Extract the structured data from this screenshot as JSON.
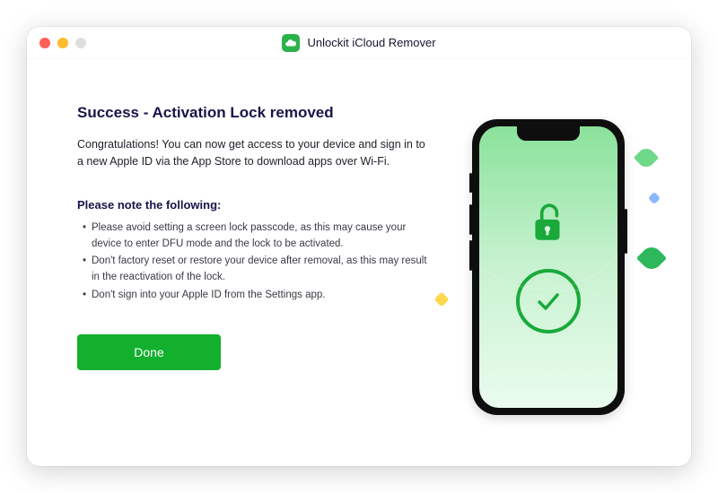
{
  "app": {
    "title": "Unlockit iCloud Remover"
  },
  "main": {
    "heading": "Success - Activation Lock removed",
    "intro": "Congratulations! You can now get access to your device and sign in to a new Apple ID via the App Store to download apps over Wi-Fi.",
    "note_heading": "Please note the following:",
    "notes": [
      "Please avoid setting a screen lock passcode, as this may cause your device to enter DFU mode and the lock to be activated.",
      "Don't factory reset or restore your device after removal, as this may result in the reactivation of the lock.",
      "Don't sign into your Apple ID from the Settings app."
    ],
    "done_label": "Done"
  },
  "colors": {
    "accent": "#13b02d"
  }
}
